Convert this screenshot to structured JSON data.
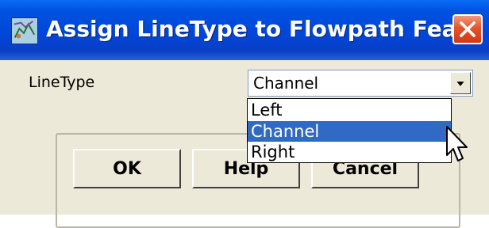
{
  "window": {
    "title": "Assign LineType to Flowpath Fea...",
    "icons": {
      "app": "map-app-icon",
      "close": "close-icon"
    }
  },
  "form": {
    "linetype_label": "LineType",
    "combo_value": "Channel",
    "dropdown_arrow_icon": "chevron-down-icon",
    "options": [
      "Left",
      "Channel",
      "Right"
    ],
    "selected_option": "Channel"
  },
  "buttons": {
    "ok": "OK",
    "help": "Help",
    "cancel": "Cancel"
  },
  "colors": {
    "titlebar": "#0046d8",
    "selection": "#316ac5",
    "close": "#e2552a",
    "dialog_bg": "#ece9d8"
  }
}
